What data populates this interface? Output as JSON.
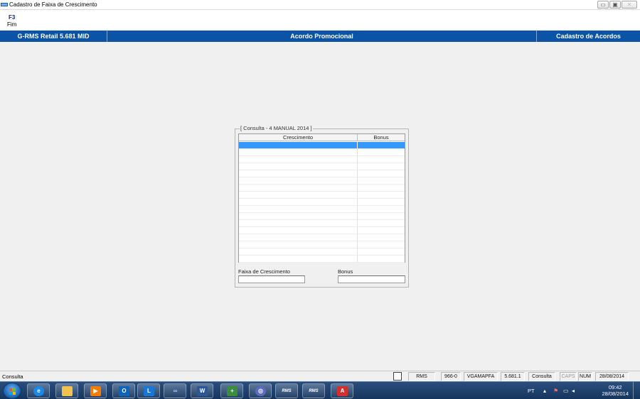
{
  "window": {
    "title": "Cadastro de Faixa de Crescimento",
    "minimize": "▭",
    "maximize": "▣",
    "close": "✕"
  },
  "fkeys": [
    {
      "key": "F3",
      "label": "Fim"
    }
  ],
  "header": {
    "left": "G-RMS Retail 5.681 MID",
    "center": "Acordo Promocional",
    "right": "Cadastro de Acordos"
  },
  "panel": {
    "legend": "[ Consulta - 4 MANUAL 2014 ]",
    "grid": {
      "columns": [
        "Crescimento",
        "Bonus"
      ],
      "rows": 17,
      "selected_row": 0
    },
    "fields": {
      "faixa_label": "Faixa de Crescimento",
      "faixa_value": "",
      "bonus_label": "Bonus",
      "bonus_value": ""
    }
  },
  "statusbar": {
    "left": "Consulta",
    "panels": [
      "RMS",
      "966-0",
      "VGAMAPFA",
      "5.681.1",
      "Consulta",
      "CAPS",
      "NUM",
      "28/08/2014"
    ]
  },
  "taskbar": {
    "apps": [
      "ie",
      "explorer",
      "media-player",
      "outlook",
      "lync",
      "app-infinity",
      "word",
      "app-plus",
      "app-globe",
      "rms-1",
      "rms-2",
      "acrobat"
    ],
    "tray": {
      "lang": "PT",
      "time": "09:42",
      "date": "28/08/2014"
    }
  }
}
